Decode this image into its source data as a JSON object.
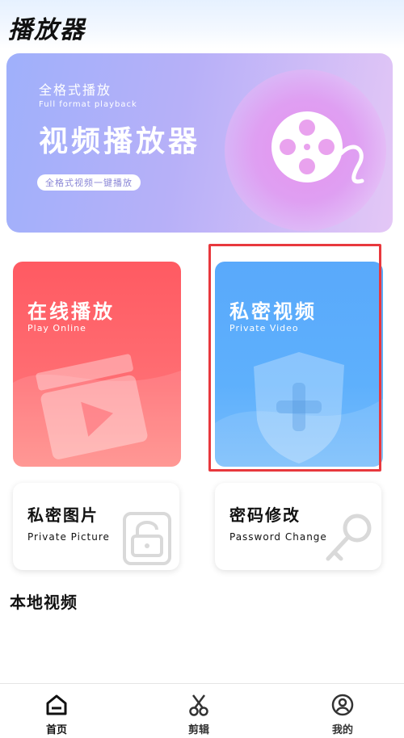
{
  "app": {
    "title": "播放器"
  },
  "banner": {
    "subtitle": "全格式播放",
    "subtitle_en": "Full format playback",
    "headline": "视频播放器",
    "chip": "全格式视频一键播放"
  },
  "cards": {
    "online": {
      "title": "在线播放",
      "subtitle": "Play Online"
    },
    "private_video": {
      "title": "私密视频",
      "subtitle": "Private Video"
    },
    "private_picture": {
      "title": "私密图片",
      "subtitle": "Private Picture"
    },
    "password_change": {
      "title": "密码修改",
      "subtitle": "Password Change"
    }
  },
  "section": {
    "local_videos": "本地视频"
  },
  "tabbar": {
    "items": [
      {
        "label": "首页",
        "icon": "home-icon",
        "active": true
      },
      {
        "label": "剪辑",
        "icon": "scissors-icon",
        "active": false
      },
      {
        "label": "我的",
        "icon": "user-icon",
        "active": false
      }
    ]
  },
  "colors": {
    "online_card": "#ff5a62",
    "private_card": "#59a9fb",
    "highlight": "#e8383d"
  }
}
